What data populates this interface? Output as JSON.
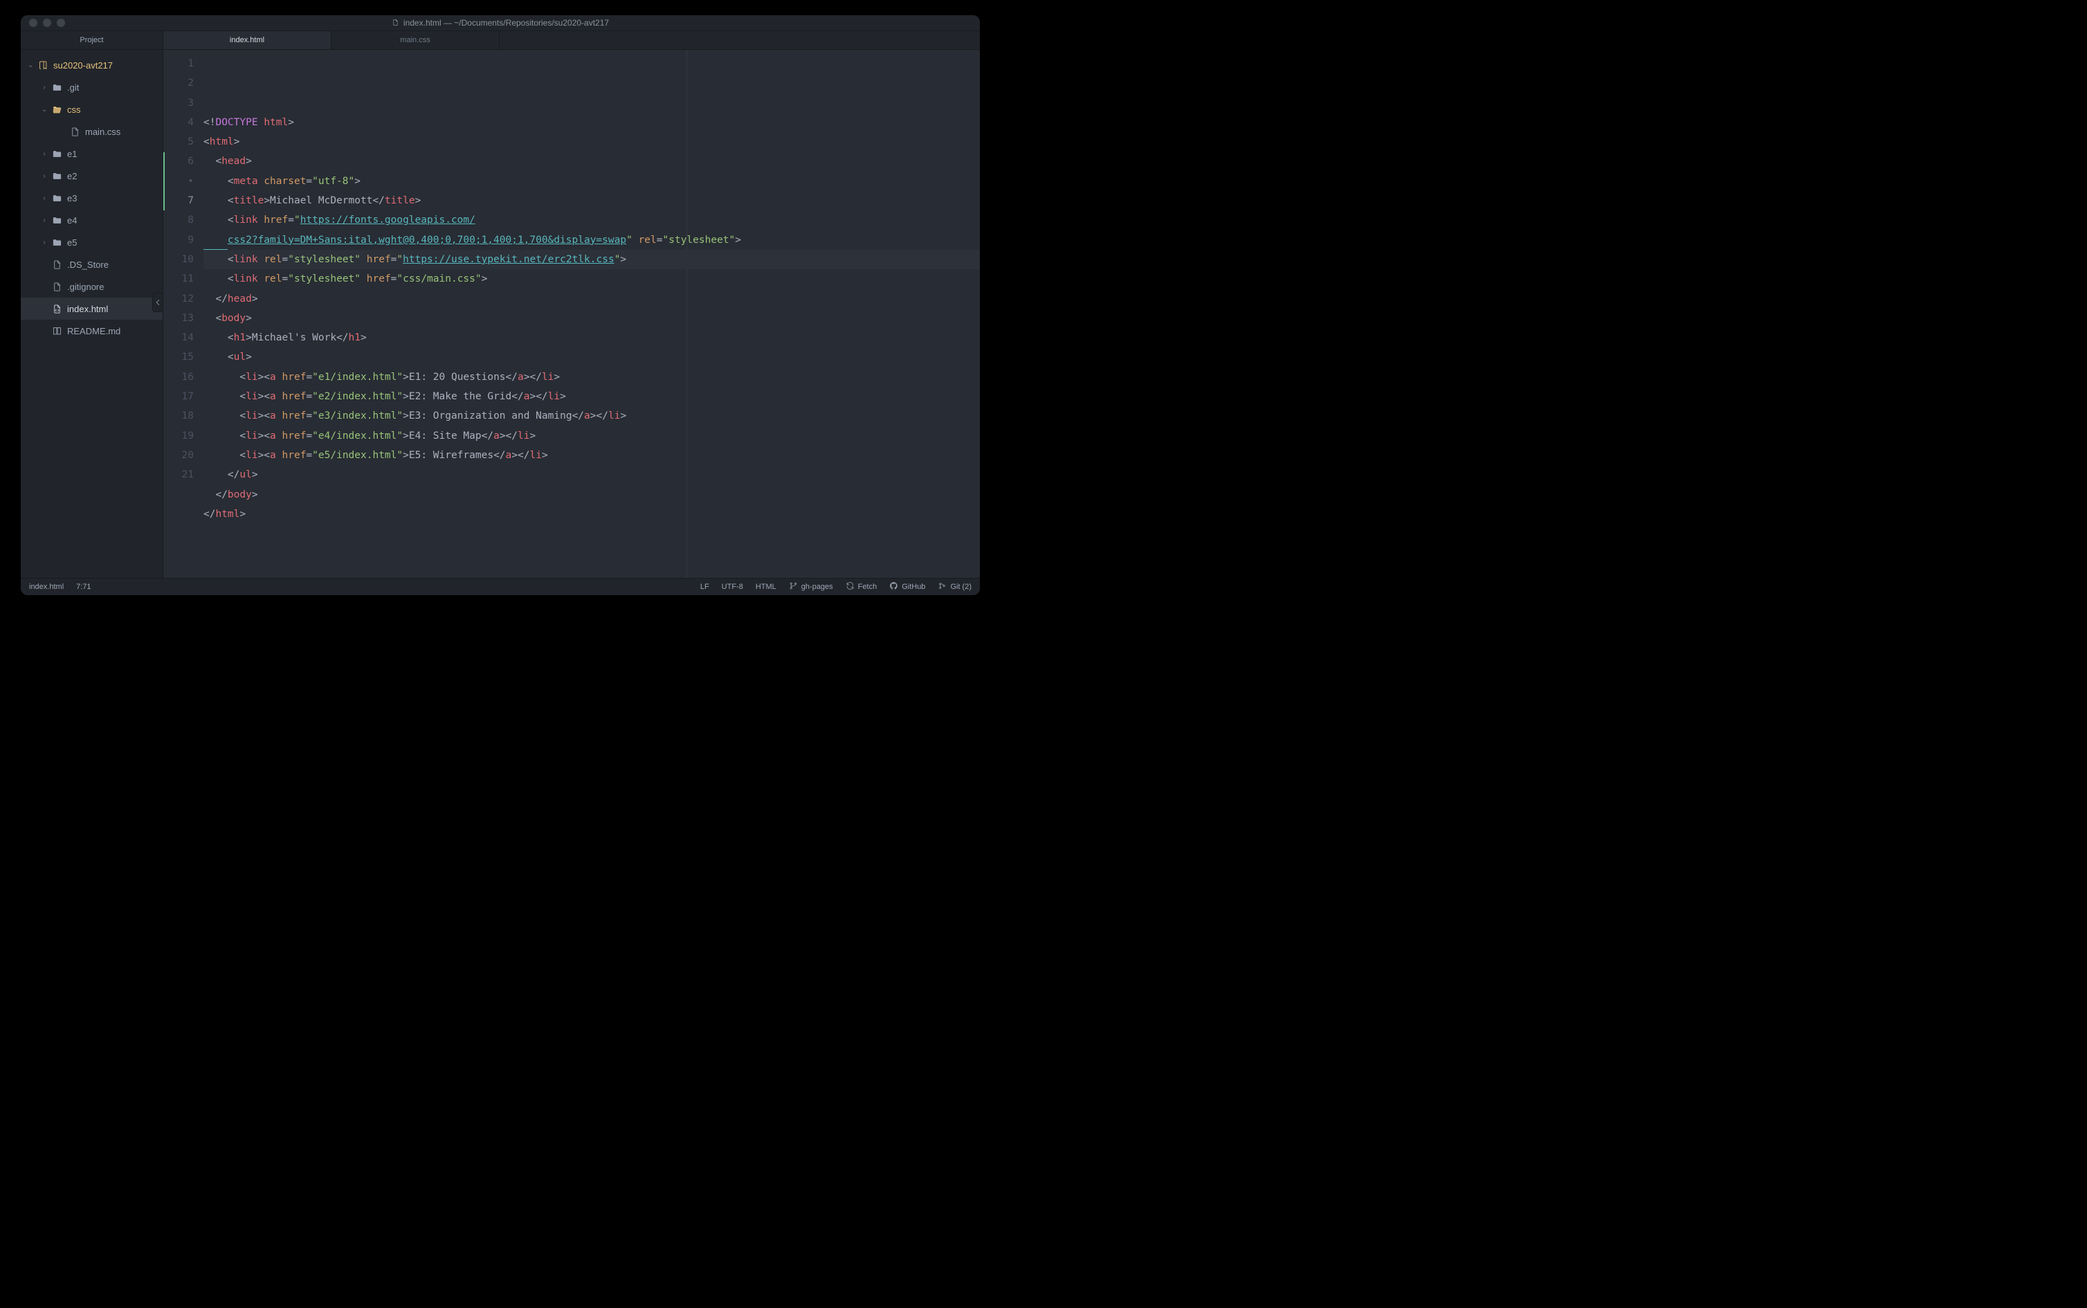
{
  "window": {
    "title": "index.html — ~/Documents/Repositories/su2020-avt217"
  },
  "sidebar": {
    "header": "Project",
    "items": [
      {
        "type": "root",
        "depth": 0,
        "arrow": "down",
        "icon": "repo",
        "label": "su2020-avt217",
        "cls": "root"
      },
      {
        "type": "folder",
        "depth": 1,
        "arrow": "right",
        "icon": "folder",
        "label": ".git"
      },
      {
        "type": "folder",
        "depth": 1,
        "arrow": "down",
        "icon": "folder-open",
        "label": "css",
        "cls": "css-open"
      },
      {
        "type": "file",
        "depth": 2,
        "arrow": "none",
        "icon": "file",
        "label": "main.css"
      },
      {
        "type": "folder",
        "depth": 1,
        "arrow": "right",
        "icon": "folder",
        "label": "e1"
      },
      {
        "type": "folder",
        "depth": 1,
        "arrow": "right",
        "icon": "folder",
        "label": "e2"
      },
      {
        "type": "folder",
        "depth": 1,
        "arrow": "right",
        "icon": "folder",
        "label": "e3"
      },
      {
        "type": "folder",
        "depth": 1,
        "arrow": "right",
        "icon": "folder",
        "label": "e4"
      },
      {
        "type": "folder",
        "depth": 1,
        "arrow": "right",
        "icon": "folder",
        "label": "e5"
      },
      {
        "type": "file",
        "depth": 1,
        "arrow": "none",
        "icon": "file",
        "label": ".DS_Store"
      },
      {
        "type": "file",
        "depth": 1,
        "arrow": "none",
        "icon": "file",
        "label": ".gitignore"
      },
      {
        "type": "file",
        "depth": 1,
        "arrow": "none",
        "icon": "code",
        "label": "index.html",
        "selected": true
      },
      {
        "type": "file",
        "depth": 1,
        "arrow": "none",
        "icon": "book",
        "label": "README.md"
      }
    ]
  },
  "tabs": [
    {
      "label": "index.html",
      "active": true
    },
    {
      "label": "main.css",
      "active": false
    }
  ],
  "gutter": {
    "numbers": [
      "1",
      "2",
      "3",
      "4",
      "5",
      "6",
      "•",
      "7",
      "8",
      "9",
      "10",
      "11",
      "12",
      "13",
      "14",
      "15",
      "16",
      "17",
      "18",
      "19",
      "20",
      "21"
    ],
    "active_index": 7,
    "git_mark_start": 5,
    "git_mark_end": 7
  },
  "code_lines": [
    [
      [
        "dk",
        "<!"
      ],
      [
        "dd",
        "DOCTYPE "
      ],
      [
        "dt",
        "html"
      ],
      [
        "dk",
        ">"
      ]
    ],
    [
      [
        "p",
        "<"
      ],
      [
        "t",
        "html"
      ],
      [
        "p",
        ">"
      ]
    ],
    [
      [
        "p",
        "  <"
      ],
      [
        "t",
        "head"
      ],
      [
        "p",
        ">"
      ]
    ],
    [
      [
        "p",
        "    <"
      ],
      [
        "t",
        "meta"
      ],
      [
        "p",
        " "
      ],
      [
        "at",
        "charset"
      ],
      [
        "eq",
        "="
      ],
      [
        "s",
        "\"utf-8\""
      ],
      [
        "p",
        ">"
      ]
    ],
    [
      [
        "p",
        "    <"
      ],
      [
        "t",
        "title"
      ],
      [
        "p",
        ">"
      ],
      [
        "txt",
        "Michael McDermott"
      ],
      [
        "p",
        "</"
      ],
      [
        "t",
        "title"
      ],
      [
        "p",
        ">"
      ]
    ],
    [
      [
        "p",
        "    <"
      ],
      [
        "t",
        "link"
      ],
      [
        "p",
        " "
      ],
      [
        "at",
        "href"
      ],
      [
        "eq",
        "="
      ],
      [
        "s",
        "\""
      ],
      [
        "url",
        "https://fonts.googleapis.com/"
      ]
    ],
    [
      [
        "wrapstart",
        "    "
      ],
      [
        "url",
        "css2?family=DM+Sans:ital,wght@0,400;0,700;1,400;1,700&display=swap"
      ],
      [
        "s",
        "\""
      ],
      [
        "p",
        " "
      ],
      [
        "at",
        "rel"
      ],
      [
        "eq",
        "="
      ],
      [
        "s",
        "\"stylesheet\""
      ],
      [
        "p",
        ">"
      ]
    ],
    [
      [
        "p",
        "    <"
      ],
      [
        "t",
        "link"
      ],
      [
        "p",
        " "
      ],
      [
        "at",
        "rel"
      ],
      [
        "eq",
        "="
      ],
      [
        "s",
        "\"stylesheet\""
      ],
      [
        "p",
        " "
      ],
      [
        "at",
        "href"
      ],
      [
        "eq",
        "="
      ],
      [
        "s",
        "\""
      ],
      [
        "url",
        "https://use.typekit.net/erc2tlk.css"
      ],
      [
        "s",
        "\""
      ],
      [
        "p",
        ">"
      ]
    ],
    [
      [
        "p",
        "    <"
      ],
      [
        "t",
        "link"
      ],
      [
        "p",
        " "
      ],
      [
        "at",
        "rel"
      ],
      [
        "eq",
        "="
      ],
      [
        "s",
        "\"stylesheet\""
      ],
      [
        "p",
        " "
      ],
      [
        "at",
        "href"
      ],
      [
        "eq",
        "="
      ],
      [
        "s",
        "\"css/main.css\""
      ],
      [
        "p",
        ">"
      ]
    ],
    [
      [
        "p",
        "  </"
      ],
      [
        "t",
        "head"
      ],
      [
        "p",
        ">"
      ]
    ],
    [
      [
        "p",
        "  <"
      ],
      [
        "t",
        "body"
      ],
      [
        "p",
        ">"
      ]
    ],
    [
      [
        "p",
        "    <"
      ],
      [
        "t",
        "h1"
      ],
      [
        "p",
        ">"
      ],
      [
        "txt",
        "Michael's Work"
      ],
      [
        "p",
        "</"
      ],
      [
        "t",
        "h1"
      ],
      [
        "p",
        ">"
      ]
    ],
    [
      [
        "p",
        "    <"
      ],
      [
        "t",
        "ul"
      ],
      [
        "p",
        ">"
      ]
    ],
    [
      [
        "p",
        "      <"
      ],
      [
        "t",
        "li"
      ],
      [
        "p",
        "><"
      ],
      [
        "t",
        "a"
      ],
      [
        "p",
        " "
      ],
      [
        "at",
        "href"
      ],
      [
        "eq",
        "="
      ],
      [
        "s",
        "\"e1/index.html\""
      ],
      [
        "p",
        ">"
      ],
      [
        "txt",
        "E1: 20 Questions"
      ],
      [
        "p",
        "</"
      ],
      [
        "t",
        "a"
      ],
      [
        "p",
        "></"
      ],
      [
        "t",
        "li"
      ],
      [
        "p",
        ">"
      ]
    ],
    [
      [
        "p",
        "      <"
      ],
      [
        "t",
        "li"
      ],
      [
        "p",
        "><"
      ],
      [
        "t",
        "a"
      ],
      [
        "p",
        " "
      ],
      [
        "at",
        "href"
      ],
      [
        "eq",
        "="
      ],
      [
        "s",
        "\"e2/index.html\""
      ],
      [
        "p",
        ">"
      ],
      [
        "txt",
        "E2: Make the Grid"
      ],
      [
        "p",
        "</"
      ],
      [
        "t",
        "a"
      ],
      [
        "p",
        "></"
      ],
      [
        "t",
        "li"
      ],
      [
        "p",
        ">"
      ]
    ],
    [
      [
        "p",
        "      <"
      ],
      [
        "t",
        "li"
      ],
      [
        "p",
        "><"
      ],
      [
        "t",
        "a"
      ],
      [
        "p",
        " "
      ],
      [
        "at",
        "href"
      ],
      [
        "eq",
        "="
      ],
      [
        "s",
        "\"e3/index.html\""
      ],
      [
        "p",
        ">"
      ],
      [
        "txt",
        "E3: Organization and Naming"
      ],
      [
        "p",
        "</"
      ],
      [
        "t",
        "a"
      ],
      [
        "p",
        "></"
      ],
      [
        "t",
        "li"
      ],
      [
        "p",
        ">"
      ]
    ],
    [
      [
        "p",
        "      <"
      ],
      [
        "t",
        "li"
      ],
      [
        "p",
        "><"
      ],
      [
        "t",
        "a"
      ],
      [
        "p",
        " "
      ],
      [
        "at",
        "href"
      ],
      [
        "eq",
        "="
      ],
      [
        "s",
        "\"e4/index.html\""
      ],
      [
        "p",
        ">"
      ],
      [
        "txt",
        "E4: Site Map"
      ],
      [
        "p",
        "</"
      ],
      [
        "t",
        "a"
      ],
      [
        "p",
        "></"
      ],
      [
        "t",
        "li"
      ],
      [
        "p",
        ">"
      ]
    ],
    [
      [
        "p",
        "      <"
      ],
      [
        "t",
        "li"
      ],
      [
        "p",
        "><"
      ],
      [
        "t",
        "a"
      ],
      [
        "p",
        " "
      ],
      [
        "at",
        "href"
      ],
      [
        "eq",
        "="
      ],
      [
        "s",
        "\"e5/index.html\""
      ],
      [
        "p",
        ">"
      ],
      [
        "txt",
        "E5: Wireframes"
      ],
      [
        "p",
        "</"
      ],
      [
        "t",
        "a"
      ],
      [
        "p",
        "></"
      ],
      [
        "t",
        "li"
      ],
      [
        "p",
        ">"
      ]
    ],
    [
      [
        "p",
        "    </"
      ],
      [
        "t",
        "ul"
      ],
      [
        "p",
        ">"
      ]
    ],
    [
      [
        "p",
        "  </"
      ],
      [
        "t",
        "body"
      ],
      [
        "p",
        ">"
      ]
    ],
    [
      [
        "p",
        "</"
      ],
      [
        "t",
        "html"
      ],
      [
        "p",
        ">"
      ]
    ],
    [
      [
        "p",
        ""
      ]
    ]
  ],
  "highlight_line_index": 7,
  "status": {
    "left_file": "index.html",
    "cursor": "7:71",
    "line_ending": "LF",
    "encoding": "UTF-8",
    "lang": "HTML",
    "branch": "gh-pages",
    "fetch": "Fetch",
    "github": "GitHub",
    "git": "Git (2)"
  }
}
